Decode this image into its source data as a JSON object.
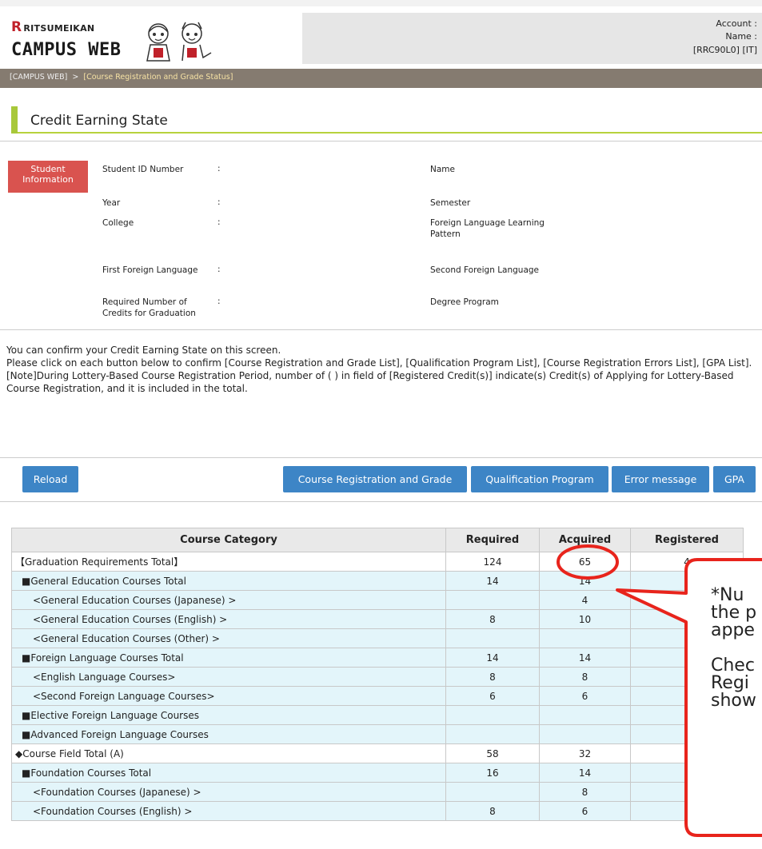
{
  "header": {
    "logo_top": "RITSUMEIKAN",
    "logo_r": "R",
    "logo_main": "CAMPUS WEB",
    "account_label": "Account :",
    "name_label": "Name :",
    "user_code": "[RRC90L0] [IT]"
  },
  "breadcrumb": {
    "home": "[CAMPUS WEB]",
    "separator": ">",
    "current": "[Course Registration and Grade Status]"
  },
  "page_title": "Credit Earning State",
  "student_info": {
    "badge": "Student Information",
    "fields_left": [
      {
        "label": "Student ID Number",
        "colon": ":"
      },
      {
        "label": "Year",
        "colon": ":"
      },
      {
        "label": "College",
        "colon": ":"
      },
      {
        "label": "First Foreign Language",
        "colon": ":"
      },
      {
        "label": "Required Number of Credits for Graduation",
        "colon": ":"
      }
    ],
    "fields_right": [
      {
        "label": "Name"
      },
      {
        "label": "Semester"
      },
      {
        "label": "Foreign Language Learning Pattern"
      },
      {
        "label": "Second Foreign Language"
      },
      {
        "label": "Degree Program"
      }
    ]
  },
  "notes": {
    "line1": "You can confirm your Credit Earning State on this screen.",
    "line2": "Please click on each button below to confirm [Course Registration and Grade List], [Qualification Program List], [Course Registration Errors List], [GPA List].",
    "line3": "[Note]During Lottery-Based Course Registration Period, number of ( ) in field of [Registered Credit(s)] indicate(s) Credit(s) of Applying for Lottery-Based Course Registration, and it is included in the total."
  },
  "buttons": {
    "reload": "Reload",
    "course_reg": "Course Registration and Grade",
    "qualification": "Qualification Program",
    "error": "Error message",
    "gpa": "GPA"
  },
  "table": {
    "headers": [
      "Course Category",
      "Required",
      "Acquired",
      "Registered"
    ],
    "rows": [
      {
        "cat": "【Graduation Requirements Total】",
        "req": "124",
        "acq": "65",
        "reg": "4"
      },
      {
        "cat": "■General Education Courses Total",
        "req": "14",
        "acq": "14",
        "reg": ""
      },
      {
        "cat": "<General Education Courses (Japanese) >",
        "req": "",
        "acq": "4",
        "reg": ""
      },
      {
        "cat": "<General Education Courses (English) >",
        "req": "8",
        "acq": "10",
        "reg": ""
      },
      {
        "cat": "<General Education Courses (Other) >",
        "req": "",
        "acq": "",
        "reg": ""
      },
      {
        "cat": "■Foreign Language Courses Total",
        "req": "14",
        "acq": "14",
        "reg": ""
      },
      {
        "cat": "<English Language Courses>",
        "req": "8",
        "acq": "8",
        "reg": ""
      },
      {
        "cat": "<Second Foreign Language Courses>",
        "req": "6",
        "acq": "6",
        "reg": ""
      },
      {
        "cat": "■Elective Foreign Language Courses",
        "req": "",
        "acq": "",
        "reg": ""
      },
      {
        "cat": "■Advanced Foreign Language Courses",
        "req": "",
        "acq": "",
        "reg": ""
      },
      {
        "cat": "◆Course Field Total (A)",
        "req": "58",
        "acq": "32",
        "reg": ""
      },
      {
        "cat": "■Foundation Courses Total",
        "req": "16",
        "acq": "14",
        "reg": ""
      },
      {
        "cat": "<Foundation Courses (Japanese) >",
        "req": "",
        "acq": "8",
        "reg": ""
      },
      {
        "cat": "<Foundation Courses (English) >",
        "req": "8",
        "acq": "6",
        "reg": ""
      }
    ]
  },
  "callout": {
    "line1": "*Nu",
    "line2": "the p",
    "line3": "appe",
    "line4": "Chec",
    "line5": "Regi",
    "line6": "show"
  },
  "colors": {
    "accent_red": "#e8241c",
    "button_blue": "#3d85c6",
    "title_green": "#a8c83a",
    "highlight_row": "#e3f5fa"
  }
}
